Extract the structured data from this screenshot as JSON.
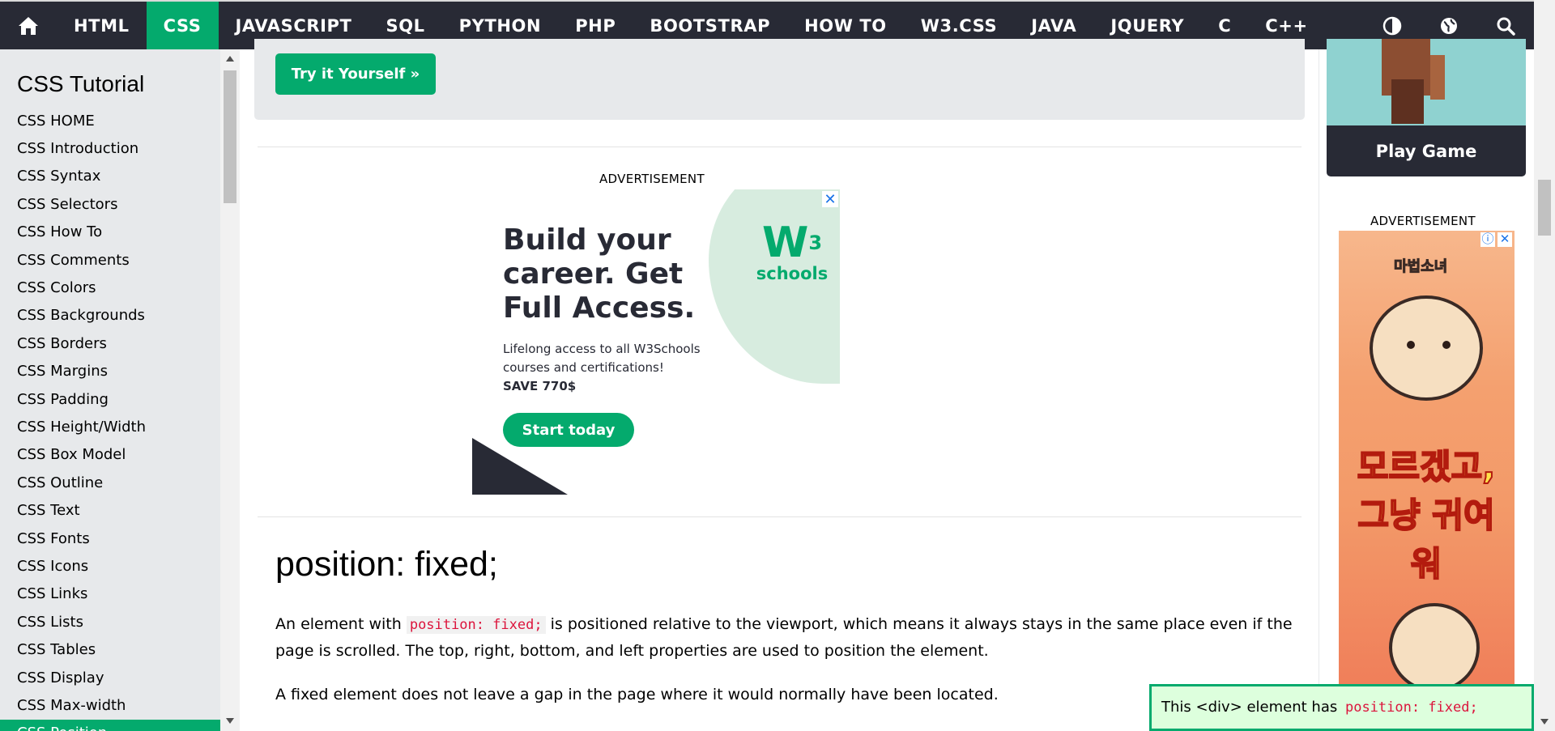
{
  "nav": {
    "items": [
      "HTML",
      "CSS",
      "JAVASCRIPT",
      "SQL",
      "PYTHON",
      "PHP",
      "BOOTSTRAP",
      "HOW TO",
      "W3.CSS",
      "JAVA",
      "JQUERY",
      "C",
      "C++"
    ],
    "active": "CSS",
    "icons": [
      "home-icon",
      "contrast-icon",
      "globe-icon",
      "search-icon"
    ]
  },
  "sidebar": {
    "title": "CSS Tutorial",
    "items": [
      "CSS HOME",
      "CSS Introduction",
      "CSS Syntax",
      "CSS Selectors",
      "CSS How To",
      "CSS Comments",
      "CSS Colors",
      "CSS Backgrounds",
      "CSS Borders",
      "CSS Margins",
      "CSS Padding",
      "CSS Height/Width",
      "CSS Box Model",
      "CSS Outline",
      "CSS Text",
      "CSS Fonts",
      "CSS Icons",
      "CSS Links",
      "CSS Lists",
      "CSS Tables",
      "CSS Display",
      "CSS Max-width",
      "CSS Position"
    ]
  },
  "main": {
    "try_button": "Try it Yourself »",
    "advertisement_label": "ADVERTISEMENT",
    "ad": {
      "headline": "Build your career. Get Full Access.",
      "body": "Lifelong access to all W3Schools courses and certifications!",
      "save": "SAVE 770$",
      "cta": "Start today",
      "logo_mark": "W",
      "logo_sup": "3",
      "logo_text": "schools",
      "close": "✕"
    },
    "heading": "position: fixed;",
    "para1_before": "An element with",
    "para1_code": "position: fixed;",
    "para1_after": "is positioned relative to the viewport, which means it always stays in the same place even if the page is scrolled. The top, right, bottom, and left properties are used to position the element.",
    "para2": "A fixed element does not leave a gap in the page where it would normally have been located."
  },
  "right": {
    "play_game": "Play Game",
    "advertisement_label": "ADVERTISEMENT",
    "ad_top_text": "마법소녀",
    "ad_main_text": "모르겠고, 그냥 귀여워",
    "info": "ⓘ",
    "close": "✕"
  },
  "fixed_div": {
    "text": "This <div> element has",
    "code": "position: fixed;"
  },
  "colors": {
    "accent": "#04AA6D",
    "nav_bg": "#282A35",
    "sidebar_bg": "#E7E9EB",
    "code": "#dc143c",
    "fixed_bg": "#DDFFDD"
  }
}
